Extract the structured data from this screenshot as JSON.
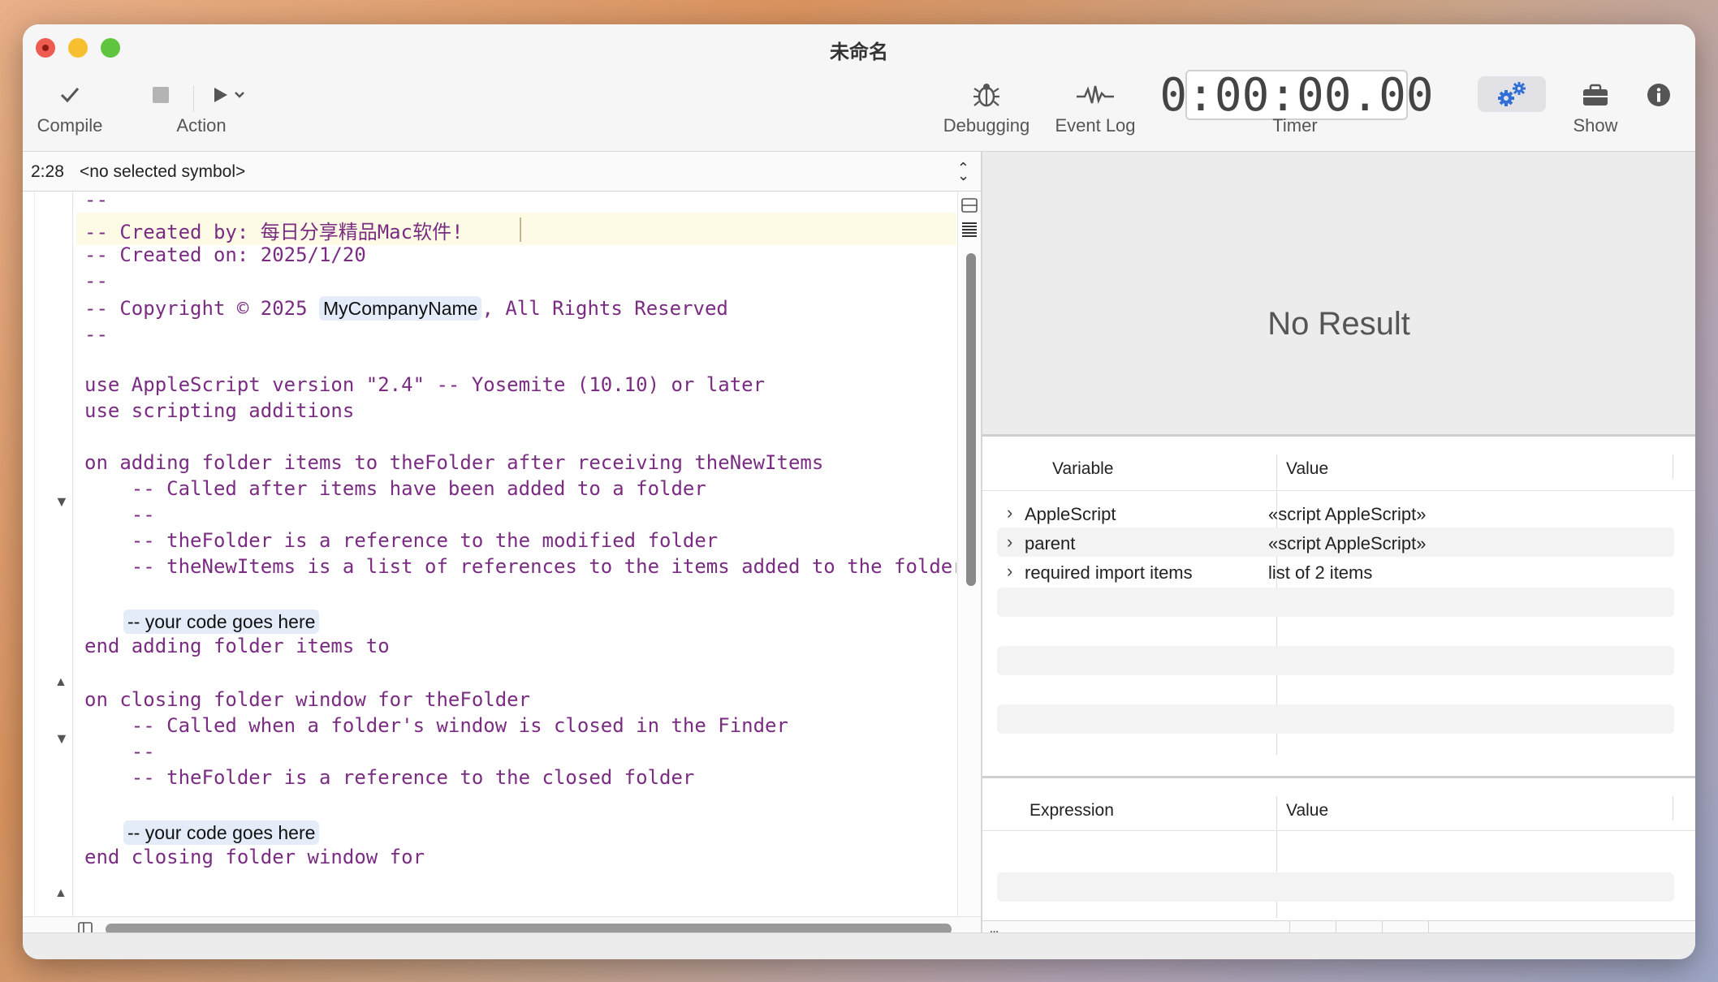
{
  "window": {
    "title": "未命名"
  },
  "toolbar": {
    "compile_label": "Compile",
    "action_label": "Action",
    "debugging_label": "Debugging",
    "event_log_label": "Event Log",
    "timer_label": "Timer",
    "timer_value": "0:00:00.00",
    "show_label": "Show"
  },
  "navbar": {
    "position": "2:28",
    "symbol": "<no selected symbol>"
  },
  "editor": {
    "lines": [
      "--",
      "-- Created by: 每日分享精品Mac软件!",
      "-- Created on: 2025/1/20",
      "--",
      "-- Copyright © 2025 ",
      ", All Rights Reserved",
      "--",
      "use AppleScript version \"2.4\" -- Yosemite (10.10) or later",
      "use scripting additions",
      "on adding folder items to theFolder after receiving theNewItems",
      "    -- Called after items have been added to a folder",
      "    --",
      "    -- theFolder is a reference to the modified folder",
      "    -- theNewItems is a list of references to the items added to the folder",
      "end adding folder items to",
      "on closing folder window for theFolder",
      "    -- Called when a folder's window is closed in the Finder",
      "    --",
      "    -- theFolder is a reference to the closed folder",
      "end closing folder window for"
    ],
    "company_placeholder": "MyCompanyName",
    "code_placeholder_1": "-- your code goes here",
    "code_placeholder_2": "-- your code goes here"
  },
  "result": {
    "text": "No Result"
  },
  "variables": {
    "col_variable": "Variable",
    "col_value": "Value",
    "rows": [
      {
        "name": "AppleScript",
        "value": "«script AppleScript»"
      },
      {
        "name": "parent",
        "value": "«script AppleScript»"
      },
      {
        "name": "required import items",
        "value": "list of 2 items"
      }
    ]
  },
  "expressions": {
    "col_expression": "Expression",
    "col_value": "Value"
  },
  "colors": {
    "code_text": "#7a2c82",
    "accent": "#2f6fd6",
    "current_line": "#fdfbe5"
  }
}
